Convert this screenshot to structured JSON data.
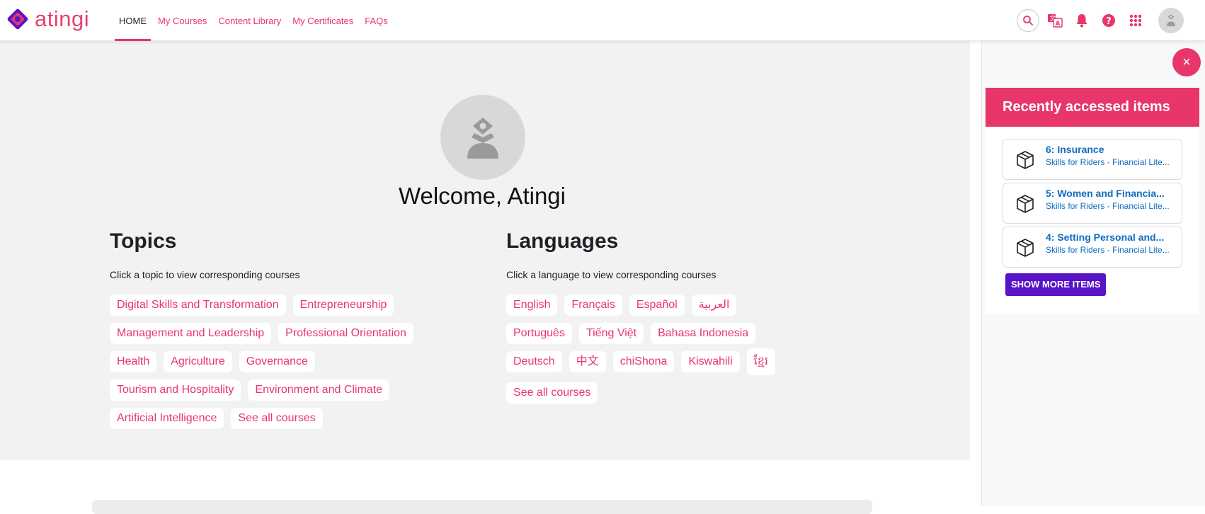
{
  "brand": {
    "name": "atingi",
    "accent": "#e8356a",
    "logo_colors": [
      "#5a14c8",
      "#e8356a"
    ]
  },
  "nav": {
    "links": [
      {
        "label": "HOME",
        "active": true
      },
      {
        "label": "My Courses"
      },
      {
        "label": "Content Library"
      },
      {
        "label": "My Certificates"
      },
      {
        "label": "FAQs"
      }
    ],
    "icons": [
      "search-icon",
      "translate-icon",
      "bell-icon",
      "help-icon",
      "apps-grid-icon",
      "user-avatar-icon"
    ]
  },
  "main": {
    "welcome": "Welcome, Atingi",
    "topics": {
      "title": "Topics",
      "subtitle": "Click a topic to view corresponding courses",
      "chips": [
        "Digital Skills and Transformation",
        "Entrepreneurship",
        "Management and Leadership",
        "Professional Orientation",
        "Health",
        "Agriculture",
        "Governance",
        "Tourism and Hospitality",
        "Environment and Climate",
        "Artificial Intelligence",
        "See all courses"
      ]
    },
    "languages": {
      "title": "Languages",
      "subtitle": "Click a language to view corresponding courses",
      "chips": [
        "English",
        "Français",
        "Español",
        "العربية",
        "Português",
        "Tiếng Việt",
        "Bahasa Indonesia",
        "Deutsch",
        "中文",
        "chiShona",
        "Kiswahili",
        "ខ្មែរ",
        "See all courses"
      ]
    }
  },
  "drawer": {
    "close": "×",
    "title": "Recently accessed items",
    "items": [
      {
        "title": "6: Insurance",
        "subtitle": "Skills for Riders - Financial Lite..."
      },
      {
        "title": "5: Women and Financia...",
        "subtitle": "Skills for Riders - Financial Lite..."
      },
      {
        "title": "4: Setting Personal and...",
        "subtitle": "Skills for Riders - Financial Lite..."
      }
    ],
    "show_more": "SHOW MORE ITEMS",
    "show_more_color": "#5a14c8"
  }
}
